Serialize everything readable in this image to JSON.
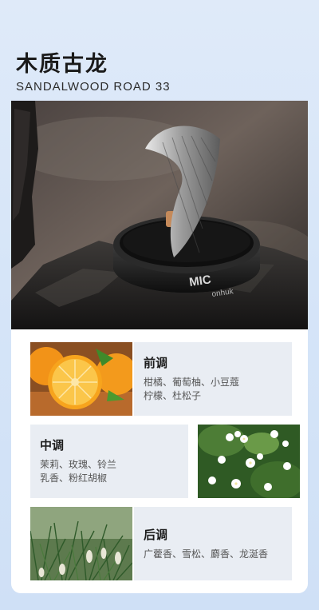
{
  "header": {
    "title": "木质古龙",
    "subtitle": "SANDALWOOD ROAD 33"
  },
  "hero": {
    "brand_text": "MIC",
    "brand_sub": "onhuk"
  },
  "notes": [
    {
      "name": "前调",
      "lines": [
        "柑橘、葡萄柚、小豆蔻",
        "柠檬、杜松子"
      ]
    },
    {
      "name": "中调",
      "lines": [
        "茉莉、玫瑰、铃兰",
        "乳香、粉红胡椒"
      ]
    },
    {
      "name": "后调",
      "lines": [
        "广藿香、雪松、麝香、龙涎香"
      ]
    }
  ],
  "colors": {
    "background": "#d6e5f8",
    "panel": "#e9edf3",
    "accent_orange": "#f08a14"
  }
}
